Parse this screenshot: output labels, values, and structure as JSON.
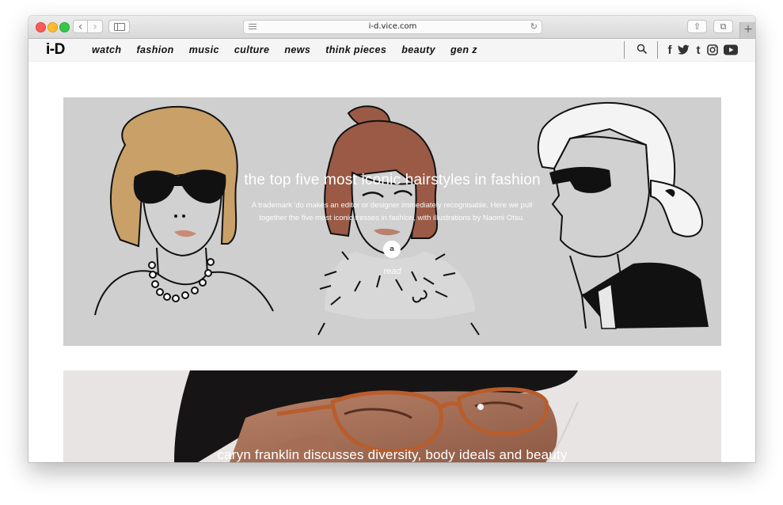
{
  "browser": {
    "url": "i-d.vice.com",
    "back_glyph": "‹",
    "forward_glyph": "›",
    "reload_glyph": "↻",
    "share_glyph": "⇧",
    "tabs_glyph": "⧉",
    "new_tab_glyph": "+",
    "icons": [
      "back-icon",
      "forward-icon",
      "sidebar-icon",
      "reader-icon",
      "reload-icon",
      "share-icon",
      "tabs-icon",
      "new-tab-icon"
    ]
  },
  "site": {
    "logo": "i-D",
    "nav": [
      "watch",
      "fashion",
      "music",
      "culture",
      "news",
      "think pieces",
      "beauty",
      "gen z"
    ],
    "social": {
      "facebook": "f",
      "tumblr": "t"
    },
    "icons": [
      "search-icon",
      "facebook-icon",
      "twitter-icon",
      "tumblr-icon",
      "instagram-icon",
      "youtube-icon"
    ]
  },
  "articles": [
    {
      "title": "the top five most iconic hairstyles in fashion",
      "subtitle_line1": "A trademark 'do makes an editor or designer immediately recognisable. Here we pull",
      "subtitle_line2": "together the five most iconic tresses in fashion, with illustrations by Naomi Otsu.",
      "read_icon": "a",
      "read_label": "read"
    },
    {
      "title": "caryn franklin discusses diversity, body ideals and beauty"
    }
  ],
  "colors": {
    "card_background": "#cfcfcf",
    "nav_background": "#f5f5f5",
    "hair_gold": "#c9a068",
    "hair_brown": "#9b5a46"
  }
}
